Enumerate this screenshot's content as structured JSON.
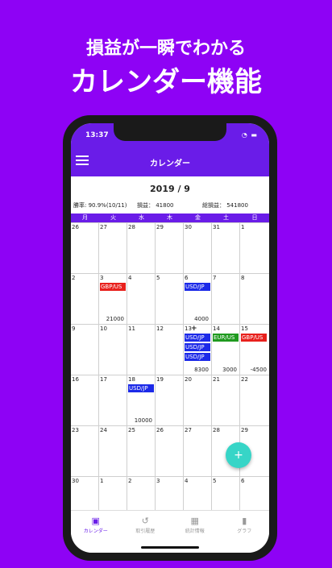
{
  "headline": {
    "line1": "損益が一瞬でわかる",
    "line2": "カレンダー機能"
  },
  "status": {
    "time": "13:37",
    "icons": "wifi battery"
  },
  "appbar": {
    "title": "カレンダー",
    "menu_icon": "hamburger-icon"
  },
  "calendar": {
    "month_label": "2019 / 9",
    "stats": {
      "win_rate": "勝率: 90.9%(10/11)",
      "profit": "損益： 41800",
      "total_profit": "総損益： 541800"
    },
    "weekdays": [
      "月",
      "火",
      "水",
      "木",
      "金",
      "土",
      "日"
    ],
    "weeks": [
      [
        {
          "day": "26"
        },
        {
          "day": "27"
        },
        {
          "day": "28"
        },
        {
          "day": "29"
        },
        {
          "day": "30"
        },
        {
          "day": "31"
        },
        {
          "day": "1"
        }
      ],
      [
        {
          "day": "2"
        },
        {
          "day": "3",
          "trades": [
            {
              "pair": "GBP/US",
              "color": "#e8201c"
            }
          ],
          "amount": "21000"
        },
        {
          "day": "4"
        },
        {
          "day": "5"
        },
        {
          "day": "6",
          "trades": [
            {
              "pair": "USD/JP",
              "color": "#1c2ae8"
            }
          ],
          "amount": "4000"
        },
        {
          "day": "7"
        },
        {
          "day": "8"
        }
      ],
      [
        {
          "day": "9"
        },
        {
          "day": "10"
        },
        {
          "day": "11"
        },
        {
          "day": "12"
        },
        {
          "day": "13",
          "plus": "+",
          "trades": [
            {
              "pair": "USD/JP",
              "color": "#1c2ae8"
            },
            {
              "pair": "USD/JP",
              "color": "#1c2ae8"
            },
            {
              "pair": "USD/JP",
              "color": "#1c2ae8"
            }
          ],
          "amount": "8300"
        },
        {
          "day": "14",
          "trades": [
            {
              "pair": "EUR/US",
              "color": "#1f9a1f"
            }
          ],
          "amount": "3000"
        },
        {
          "day": "15",
          "trades": [
            {
              "pair": "GBP/US",
              "color": "#e8201c"
            }
          ],
          "amount": "-4500"
        }
      ],
      [
        {
          "day": "16"
        },
        {
          "day": "17"
        },
        {
          "day": "18",
          "trades": [
            {
              "pair": "USD/JP",
              "color": "#1c2ae8"
            }
          ],
          "amount": "10000"
        },
        {
          "day": "19"
        },
        {
          "day": "20"
        },
        {
          "day": "21"
        },
        {
          "day": "22"
        }
      ],
      [
        {
          "day": "23"
        },
        {
          "day": "24"
        },
        {
          "day": "25"
        },
        {
          "day": "26"
        },
        {
          "day": "27"
        },
        {
          "day": "28"
        },
        {
          "day": "29"
        }
      ],
      [
        {
          "day": "30"
        },
        {
          "day": "1"
        },
        {
          "day": "2"
        },
        {
          "day": "3"
        },
        {
          "day": "4"
        },
        {
          "day": "5"
        },
        {
          "day": "6"
        }
      ]
    ]
  },
  "fab": {
    "label": "+"
  },
  "bottom_nav": [
    {
      "label": "カレンダー",
      "icon": "calendar-icon",
      "glyph": "▣",
      "active": true
    },
    {
      "label": "取引履歴",
      "icon": "history-icon",
      "glyph": "↺",
      "active": false
    },
    {
      "label": "統計情報",
      "icon": "calculator-icon",
      "glyph": "▦",
      "active": false
    },
    {
      "label": "グラフ",
      "icon": "bar-chart-icon",
      "glyph": "▮",
      "active": false
    }
  ],
  "colors": {
    "background": "#8e02f5",
    "appbar": "#6a1ce8",
    "fab": "#37d5c7"
  }
}
